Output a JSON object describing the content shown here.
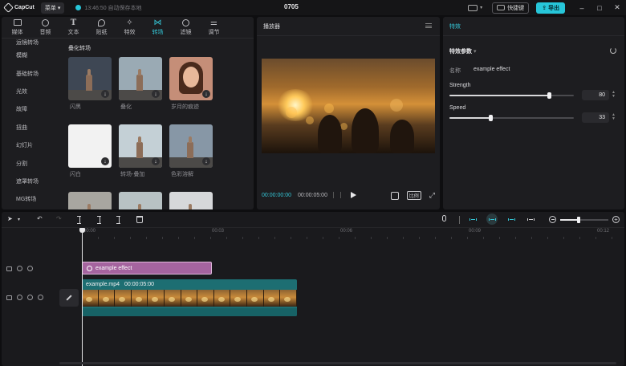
{
  "titlebar": {
    "app_name": "CapCut",
    "menu_label": "菜单",
    "autosave_text": "13:46:50 自动保存本地",
    "project_title": "0705",
    "shortcut_label": "快捷键",
    "export_label": "导出",
    "window_buttons": [
      "–",
      "□",
      "✕"
    ]
  },
  "media_tabs": [
    {
      "label": "媒体",
      "icon": "media-icon"
    },
    {
      "label": "音频",
      "icon": "audio-icon"
    },
    {
      "label": "文本",
      "icon": "text-icon"
    },
    {
      "label": "贴纸",
      "icon": "sticker-icon"
    },
    {
      "label": "特效",
      "icon": "effects-icon"
    },
    {
      "label": "转场",
      "icon": "transition-icon",
      "active": true
    },
    {
      "label": "滤镜",
      "icon": "filter-icon"
    },
    {
      "label": "调节",
      "icon": "adjust-icon"
    }
  ],
  "sidebar": {
    "items": [
      "运镜转场",
      "模糊",
      "基础转场",
      "光效",
      "故障",
      "扭曲",
      "幻灯片",
      "分割",
      "遮罩转场",
      "MG转场"
    ]
  },
  "transitions": {
    "section_title": "叠化转场",
    "items": [
      {
        "label": "闪黑",
        "bg": "#3e4754",
        "tower": true,
        "download": true
      },
      {
        "label": "叠化",
        "bg": "#9aaab4",
        "tower": true,
        "download": true
      },
      {
        "label": "岁月的痕迹",
        "bg": "#c58e78",
        "portrait": true,
        "download": true
      },
      {
        "label": "闪白",
        "bg": "#f2f2f2",
        "tower": false,
        "download": true
      },
      {
        "label": "转场-叠加",
        "bg": "#c4d0d6",
        "tower": true,
        "download": true
      },
      {
        "label": "色彩溶解",
        "bg": "#8797a6",
        "tower": true,
        "download": true
      },
      {
        "label": "",
        "bg": "#a8a6a0",
        "tower": true,
        "download": false
      },
      {
        "label": "",
        "bg": "#b8c2c4",
        "tower": true,
        "download": false
      },
      {
        "label": "",
        "bg": "#d6d8da",
        "tower": true,
        "download": false
      }
    ]
  },
  "player": {
    "title": "播放器",
    "current_time": "00:00:00:00",
    "total_time": "00:00:05:00",
    "ratio_label": "比例"
  },
  "properties": {
    "tab": "特效",
    "section": "特效参数",
    "name_label": "名称",
    "name_value": "example effect",
    "sliders": [
      {
        "label": "Strength",
        "value": "80",
        "fraction": 0.8
      },
      {
        "label": "Speed",
        "value": "33",
        "fraction": 0.33
      }
    ]
  },
  "timeline": {
    "ruler": [
      "00:00",
      "00:03",
      "00:06",
      "00:09",
      "00:12"
    ],
    "effect_clip": "example effect",
    "video_clip": {
      "name": "example.mp4",
      "duration": "00:00:05:00"
    },
    "zoom_fraction": 0.35
  },
  "colors": {
    "accent": "#27c6d9",
    "effect_clip": "#a5649f",
    "video_clip": "#1d6e72"
  }
}
